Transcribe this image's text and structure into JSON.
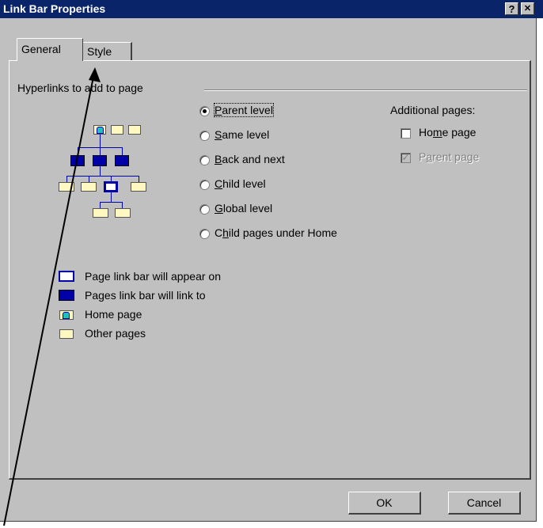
{
  "window": {
    "title": "Link Bar Properties",
    "help_button": "?",
    "close_button": "✕"
  },
  "tabs": {
    "general": "General",
    "style": "Style"
  },
  "group": {
    "title": "Hyperlinks to add to page"
  },
  "radios": [
    {
      "pre": "",
      "key": "P",
      "post": "arent level",
      "selected": true
    },
    {
      "pre": "",
      "key": "S",
      "post": "ame level",
      "selected": false
    },
    {
      "pre": "",
      "key": "B",
      "post": "ack and next",
      "selected": false
    },
    {
      "pre": "",
      "key": "C",
      "post": "hild level",
      "selected": false
    },
    {
      "pre": "",
      "key": "G",
      "post": "lobal level",
      "selected": false
    },
    {
      "pre": "C",
      "key": "h",
      "post": "ild pages under Home",
      "selected": false
    }
  ],
  "additional": {
    "title": "Additional pages:",
    "home_pre": "Ho",
    "home_key": "m",
    "home_post": "e page",
    "home_checked": false,
    "parent_pre": "P",
    "parent_key": "a",
    "parent_post": "rent page",
    "parent_checked": true
  },
  "legend": [
    "Page link bar will appear on",
    "Pages link bar will link to",
    "Home page",
    "Other pages"
  ],
  "buttons": {
    "ok": "OK",
    "cancel": "Cancel"
  },
  "colors": {
    "titlebar": "#0a246a",
    "dialog": "#c0c0c0",
    "link_blue": "#0000a8",
    "page_yellow": "#fff8c0"
  }
}
